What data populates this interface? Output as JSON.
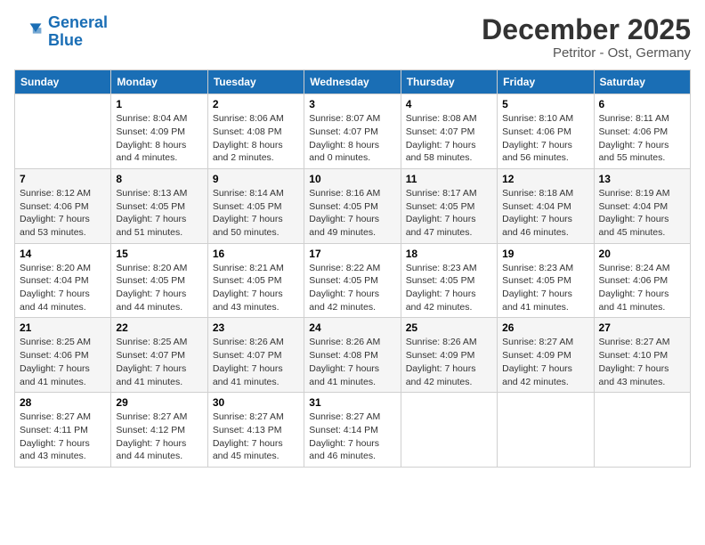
{
  "logo": {
    "line1": "General",
    "line2": "Blue"
  },
  "title": "December 2025",
  "subtitle": "Petritor - Ost, Germany",
  "days_of_week": [
    "Sunday",
    "Monday",
    "Tuesday",
    "Wednesday",
    "Thursday",
    "Friday",
    "Saturday"
  ],
  "weeks": [
    [
      {
        "day": "",
        "info": ""
      },
      {
        "day": "1",
        "info": "Sunrise: 8:04 AM\nSunset: 4:09 PM\nDaylight: 8 hours\nand 4 minutes."
      },
      {
        "day": "2",
        "info": "Sunrise: 8:06 AM\nSunset: 4:08 PM\nDaylight: 8 hours\nand 2 minutes."
      },
      {
        "day": "3",
        "info": "Sunrise: 8:07 AM\nSunset: 4:07 PM\nDaylight: 8 hours\nand 0 minutes."
      },
      {
        "day": "4",
        "info": "Sunrise: 8:08 AM\nSunset: 4:07 PM\nDaylight: 7 hours\nand 58 minutes."
      },
      {
        "day": "5",
        "info": "Sunrise: 8:10 AM\nSunset: 4:06 PM\nDaylight: 7 hours\nand 56 minutes."
      },
      {
        "day": "6",
        "info": "Sunrise: 8:11 AM\nSunset: 4:06 PM\nDaylight: 7 hours\nand 55 minutes."
      }
    ],
    [
      {
        "day": "7",
        "info": "Sunrise: 8:12 AM\nSunset: 4:06 PM\nDaylight: 7 hours\nand 53 minutes."
      },
      {
        "day": "8",
        "info": "Sunrise: 8:13 AM\nSunset: 4:05 PM\nDaylight: 7 hours\nand 51 minutes."
      },
      {
        "day": "9",
        "info": "Sunrise: 8:14 AM\nSunset: 4:05 PM\nDaylight: 7 hours\nand 50 minutes."
      },
      {
        "day": "10",
        "info": "Sunrise: 8:16 AM\nSunset: 4:05 PM\nDaylight: 7 hours\nand 49 minutes."
      },
      {
        "day": "11",
        "info": "Sunrise: 8:17 AM\nSunset: 4:05 PM\nDaylight: 7 hours\nand 47 minutes."
      },
      {
        "day": "12",
        "info": "Sunrise: 8:18 AM\nSunset: 4:04 PM\nDaylight: 7 hours\nand 46 minutes."
      },
      {
        "day": "13",
        "info": "Sunrise: 8:19 AM\nSunset: 4:04 PM\nDaylight: 7 hours\nand 45 minutes."
      }
    ],
    [
      {
        "day": "14",
        "info": "Sunrise: 8:20 AM\nSunset: 4:04 PM\nDaylight: 7 hours\nand 44 minutes."
      },
      {
        "day": "15",
        "info": "Sunrise: 8:20 AM\nSunset: 4:05 PM\nDaylight: 7 hours\nand 44 minutes."
      },
      {
        "day": "16",
        "info": "Sunrise: 8:21 AM\nSunset: 4:05 PM\nDaylight: 7 hours\nand 43 minutes."
      },
      {
        "day": "17",
        "info": "Sunrise: 8:22 AM\nSunset: 4:05 PM\nDaylight: 7 hours\nand 42 minutes."
      },
      {
        "day": "18",
        "info": "Sunrise: 8:23 AM\nSunset: 4:05 PM\nDaylight: 7 hours\nand 42 minutes."
      },
      {
        "day": "19",
        "info": "Sunrise: 8:23 AM\nSunset: 4:05 PM\nDaylight: 7 hours\nand 41 minutes."
      },
      {
        "day": "20",
        "info": "Sunrise: 8:24 AM\nSunset: 4:06 PM\nDaylight: 7 hours\nand 41 minutes."
      }
    ],
    [
      {
        "day": "21",
        "info": "Sunrise: 8:25 AM\nSunset: 4:06 PM\nDaylight: 7 hours\nand 41 minutes."
      },
      {
        "day": "22",
        "info": "Sunrise: 8:25 AM\nSunset: 4:07 PM\nDaylight: 7 hours\nand 41 minutes."
      },
      {
        "day": "23",
        "info": "Sunrise: 8:26 AM\nSunset: 4:07 PM\nDaylight: 7 hours\nand 41 minutes."
      },
      {
        "day": "24",
        "info": "Sunrise: 8:26 AM\nSunset: 4:08 PM\nDaylight: 7 hours\nand 41 minutes."
      },
      {
        "day": "25",
        "info": "Sunrise: 8:26 AM\nSunset: 4:09 PM\nDaylight: 7 hours\nand 42 minutes."
      },
      {
        "day": "26",
        "info": "Sunrise: 8:27 AM\nSunset: 4:09 PM\nDaylight: 7 hours\nand 42 minutes."
      },
      {
        "day": "27",
        "info": "Sunrise: 8:27 AM\nSunset: 4:10 PM\nDaylight: 7 hours\nand 43 minutes."
      }
    ],
    [
      {
        "day": "28",
        "info": "Sunrise: 8:27 AM\nSunset: 4:11 PM\nDaylight: 7 hours\nand 43 minutes."
      },
      {
        "day": "29",
        "info": "Sunrise: 8:27 AM\nSunset: 4:12 PM\nDaylight: 7 hours\nand 44 minutes."
      },
      {
        "day": "30",
        "info": "Sunrise: 8:27 AM\nSunset: 4:13 PM\nDaylight: 7 hours\nand 45 minutes."
      },
      {
        "day": "31",
        "info": "Sunrise: 8:27 AM\nSunset: 4:14 PM\nDaylight: 7 hours\nand 46 minutes."
      },
      {
        "day": "",
        "info": ""
      },
      {
        "day": "",
        "info": ""
      },
      {
        "day": "",
        "info": ""
      }
    ]
  ]
}
